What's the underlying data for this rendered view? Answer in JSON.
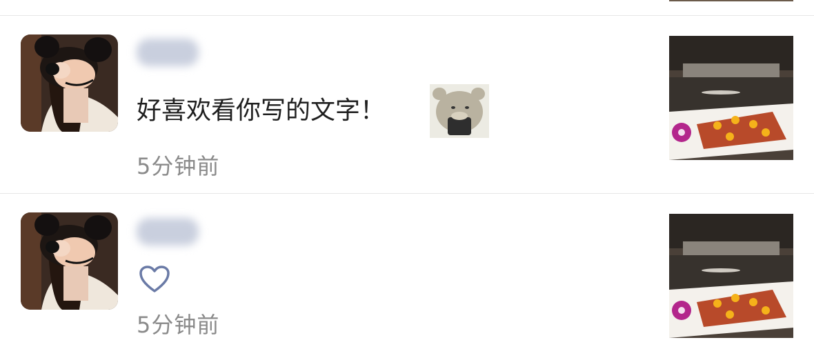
{
  "items": [
    {
      "comment": "好喜欢看你写的文字！",
      "time": "5分钟前",
      "type": "comment",
      "sticker_icon": "bear-with-phone-sticker"
    },
    {
      "comment": "",
      "time": "5分钟前",
      "type": "like",
      "like_icon": "heart-outline-icon"
    }
  ],
  "colors": {
    "divider": "#e6e6e6",
    "time_text": "#8a8a8a",
    "heart_stroke": "#6a7aa6"
  }
}
